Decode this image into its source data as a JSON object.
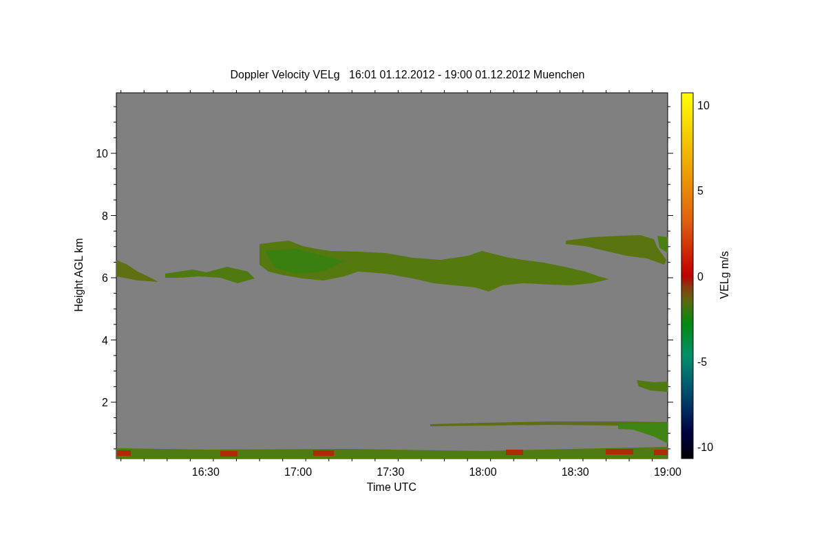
{
  "title": "Doppler Velocity VELg   16:01 01.12.2012 - 19:00 01.12.2012 Muenchen",
  "x_axis": {
    "label": "Time UTC",
    "ticks": [
      "16:30",
      "17:00",
      "17:30",
      "18:00",
      "18:30",
      "19:00"
    ]
  },
  "y_axis": {
    "label": "Height AGL km",
    "ticks": [
      "10",
      "8",
      "6",
      "4",
      "2"
    ]
  },
  "colorbar": {
    "label": "VELg m/s",
    "ticks": [
      "10",
      "5",
      "0",
      "-5",
      "-10"
    ]
  }
}
